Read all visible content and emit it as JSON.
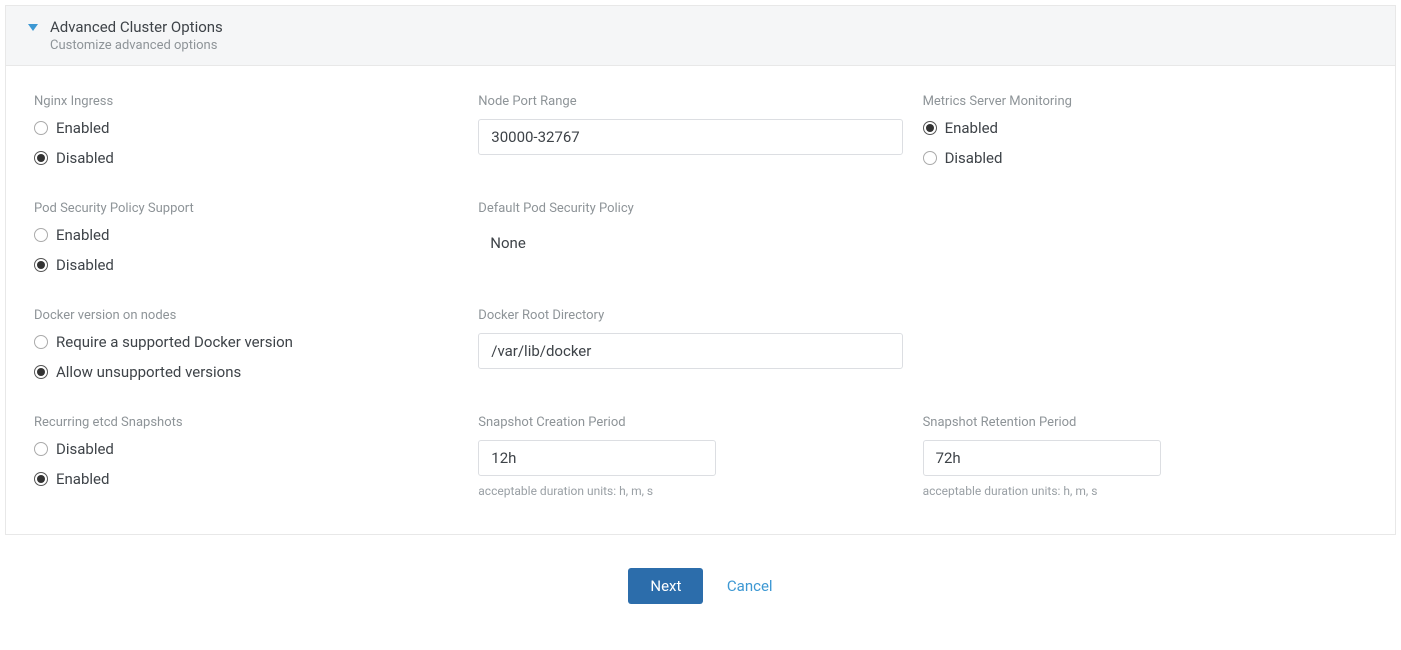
{
  "header": {
    "title": "Advanced Cluster Options",
    "subtitle": "Customize advanced options"
  },
  "nginx_ingress": {
    "label": "Nginx Ingress",
    "opt_enabled": "Enabled",
    "opt_disabled": "Disabled"
  },
  "node_port_range": {
    "label": "Node Port Range",
    "value": "30000-32767"
  },
  "metrics_server": {
    "label": "Metrics Server Monitoring",
    "opt_enabled": "Enabled",
    "opt_disabled": "Disabled"
  },
  "pod_security": {
    "label": "Pod Security Policy Support",
    "opt_enabled": "Enabled",
    "opt_disabled": "Disabled"
  },
  "default_pod_security": {
    "label": "Default Pod Security Policy",
    "value": "None"
  },
  "docker_version": {
    "label": "Docker version on nodes",
    "opt_require": "Require a supported Docker version",
    "opt_allow": "Allow unsupported versions"
  },
  "docker_root": {
    "label": "Docker Root Directory",
    "value": "/var/lib/docker"
  },
  "etcd_snapshots": {
    "label": "Recurring etcd Snapshots",
    "opt_disabled": "Disabled",
    "opt_enabled": "Enabled"
  },
  "snapshot_creation": {
    "label": "Snapshot Creation Period",
    "value": "12h",
    "hint": "acceptable duration units: h, m, s"
  },
  "snapshot_retention": {
    "label": "Snapshot Retention Period",
    "value": "72h",
    "hint": "acceptable duration units: h, m, s"
  },
  "footer": {
    "next": "Next",
    "cancel": "Cancel"
  }
}
